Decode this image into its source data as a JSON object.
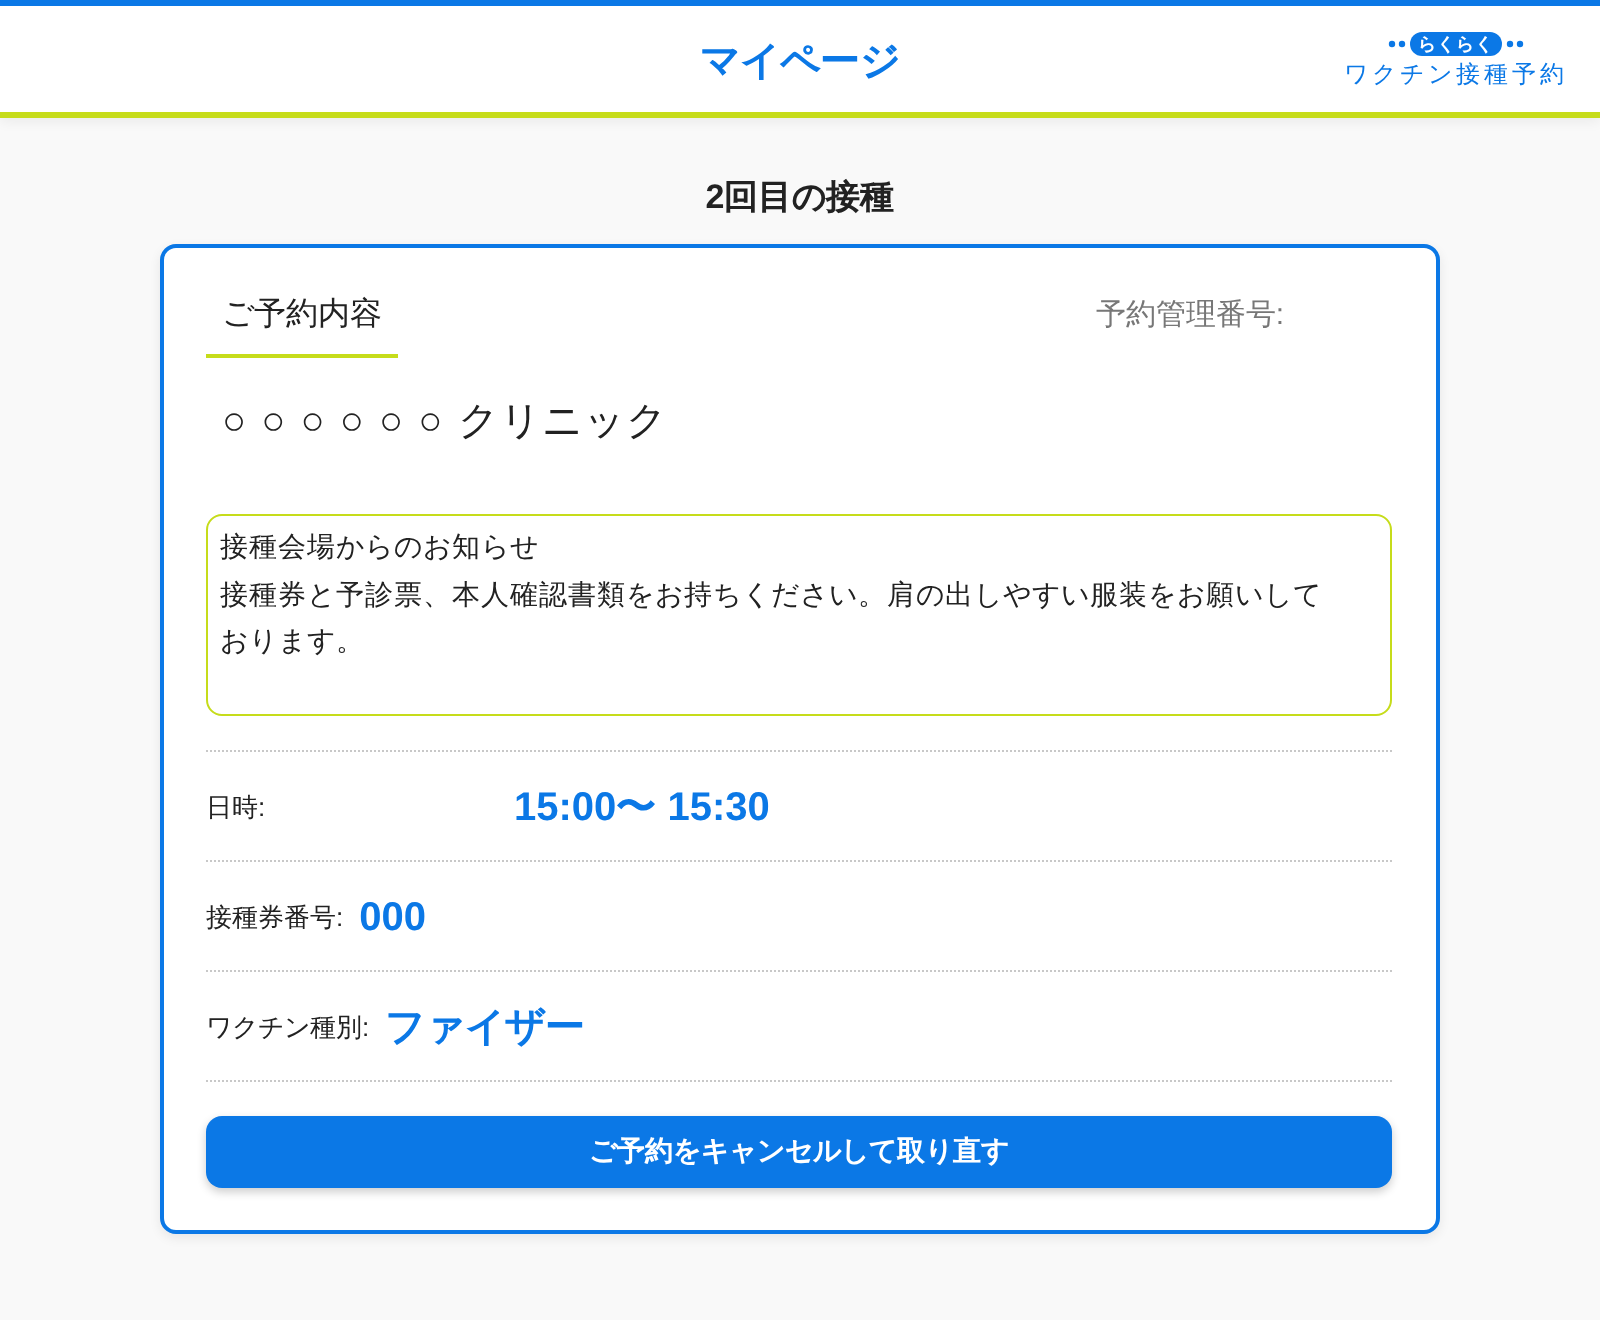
{
  "header": {
    "title": "マイページ",
    "logo": {
      "badge": "らくらく",
      "text": "ワクチン接種予約"
    }
  },
  "page_title": "2回目の接種",
  "card": {
    "tabs": [
      {
        "label": "ご予約内容",
        "selected": true
      }
    ],
    "reservation_number_label": "予約管理番号:",
    "clinic": "○ ○ ○ ○ ○ ○ クリニック",
    "notice": {
      "title": "接種会場からのお知らせ",
      "body": "接種券と予診票、本人確認書類をお持ちください。肩の出しやすい服装をお願いしております。"
    },
    "details": [
      {
        "kind": "datetime",
        "label": "日時:",
        "value": "15:00〜 15:30"
      },
      {
        "kind": "text",
        "label": "接種券番号:",
        "value": "000"
      },
      {
        "kind": "text",
        "label": "ワクチン種別:",
        "value": "ファイザー"
      }
    ],
    "button": "ご予約をキャンセルして取り直す"
  }
}
